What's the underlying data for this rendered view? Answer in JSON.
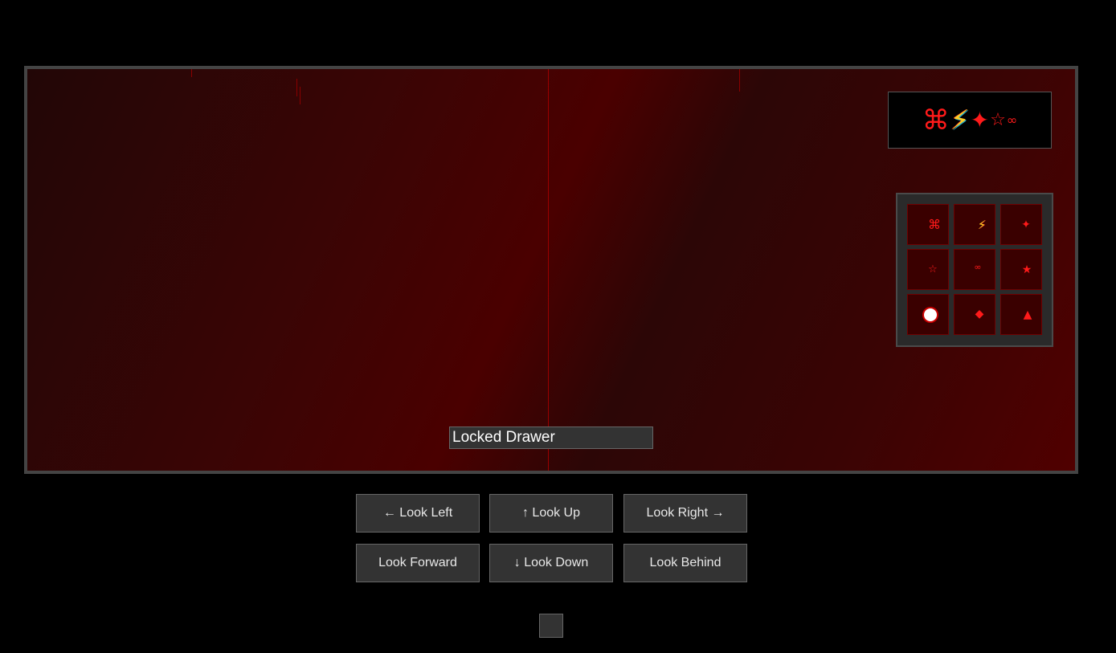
{
  "scene": {
    "location_label": "Locked Drawer"
  },
  "code_display": {
    "symbols": [
      "⌘",
      "⚡",
      "✦",
      "☆",
      "∞"
    ]
  },
  "keypad": {
    "keys": [
      "⌘",
      "⚡",
      "✦",
      "☆",
      "∞",
      "★",
      "●",
      "◆",
      "▲"
    ]
  },
  "navigation": {
    "look_left": "← Look Left",
    "look_up": "↑ Look Up",
    "look_right": "Look Right →",
    "look_forward": "Look Forward",
    "look_down": "↓ Look Down",
    "look_behind": "Look Behind"
  },
  "colors": {
    "accent_red": "#ff1a1a",
    "panel_gray": "#333333",
    "border_gray": "#666666"
  }
}
